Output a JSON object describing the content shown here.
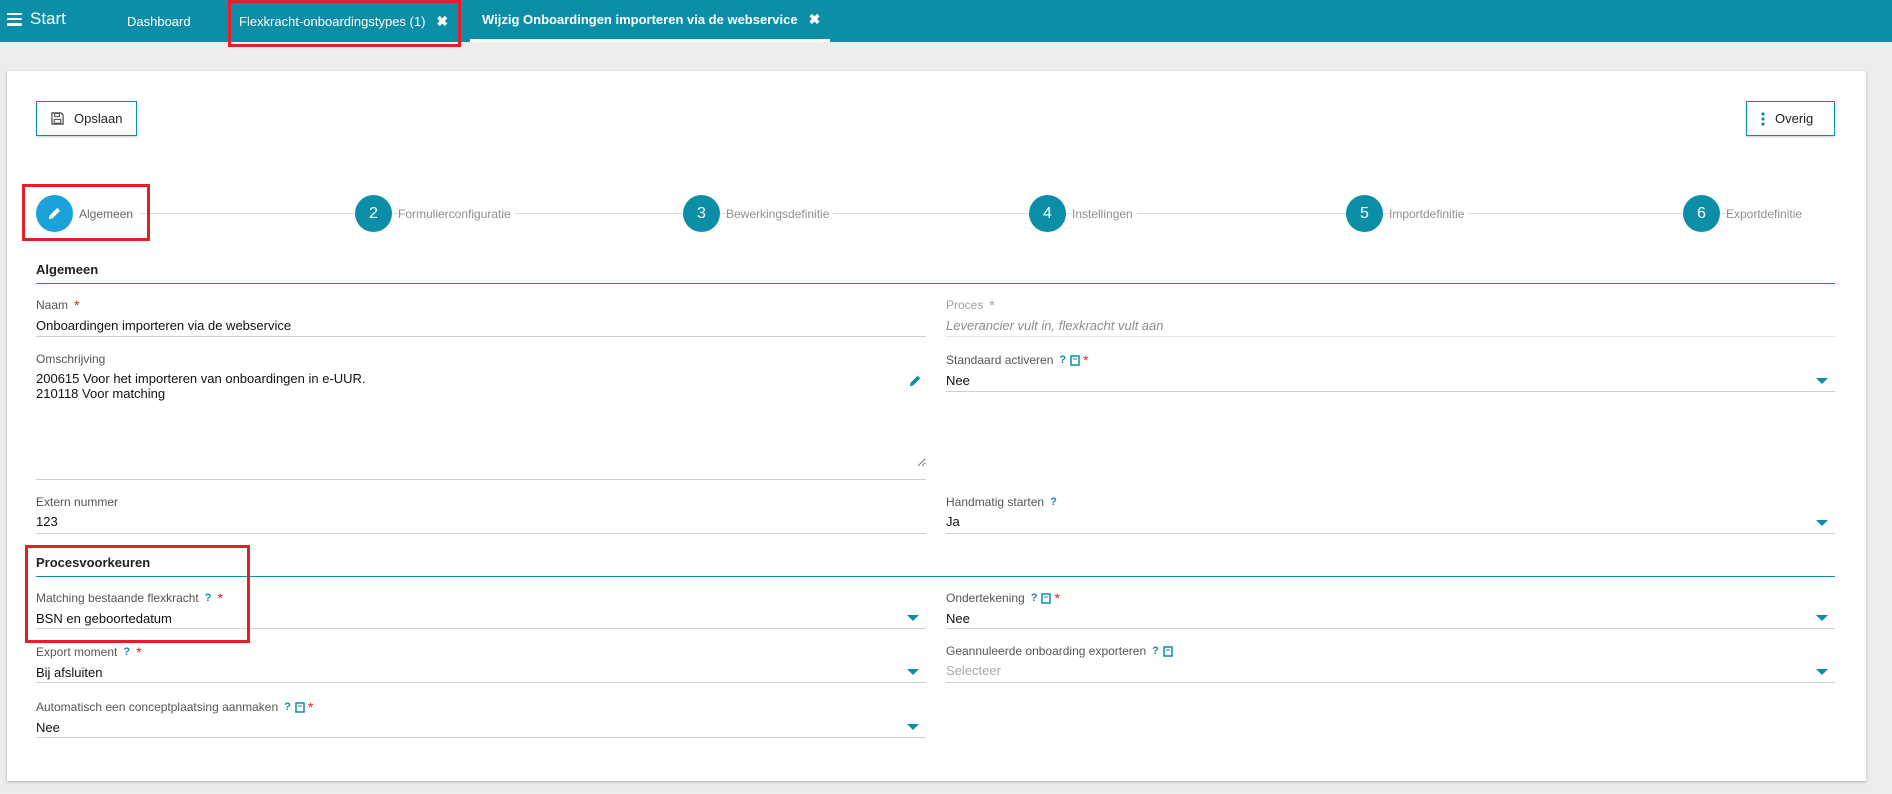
{
  "topbar": {
    "start_label": "Start",
    "tabs": [
      {
        "label": "Dashboard"
      },
      {
        "label": "Flexkracht-onboardingstypes (1)",
        "close": "✖"
      },
      {
        "label": "Wijzig Onboardingen importeren via de webservice",
        "close": "✖"
      }
    ]
  },
  "toolbar": {
    "save_label": "Opslaan",
    "more_label": "Overig"
  },
  "steps": [
    {
      "number": "",
      "icon": "pencil-icon",
      "label": "Algemeen"
    },
    {
      "number": "2",
      "label": "Formulierconfiguratie"
    },
    {
      "number": "3",
      "label": "Bewerkingsdefinitie"
    },
    {
      "number": "4",
      "label": "Instellingen"
    },
    {
      "number": "5",
      "label": "Importdefinitie"
    },
    {
      "number": "6",
      "label": "Exportdefinitie"
    }
  ],
  "sections": {
    "general": "Algemeen",
    "process": "Procesvoorkeuren"
  },
  "fields": {
    "naam": {
      "label": "Naam",
      "value": "Onboardingen importeren via de webservice"
    },
    "proces": {
      "label": "Proces",
      "value": "Leverancier vult in, flexkracht vult aan"
    },
    "omschrijving": {
      "label": "Omschrijving",
      "value": "200615 Voor het importeren van onboardingen in e-UUR.\n210118 Voor matching"
    },
    "standaard_activeren": {
      "label": "Standaard activeren",
      "value": "Nee"
    },
    "extern_nummer": {
      "label": "Extern nummer",
      "value": "123"
    },
    "handmatig_starten": {
      "label": "Handmatig starten",
      "value": "Ja"
    },
    "matching": {
      "label": "Matching bestaande flexkracht",
      "value": "BSN en geboortedatum"
    },
    "ondertekening": {
      "label": "Ondertekening",
      "value": "Nee"
    },
    "export_moment": {
      "label": "Export moment",
      "value": "Bij afsluiten"
    },
    "geannuleerde": {
      "label": "Geannuleerde onboarding exporteren",
      "placeholder": "Selecteer"
    },
    "concept": {
      "label": "Automatisch een conceptplaatsing aanmaken",
      "value": "Nee"
    }
  },
  "symbols": {
    "required": "*",
    "help": "?"
  },
  "colors": {
    "accent": "#0c8ea7",
    "active_step": "#1aa3d9",
    "required": "#e01f26",
    "highlight": "#e01f26"
  }
}
